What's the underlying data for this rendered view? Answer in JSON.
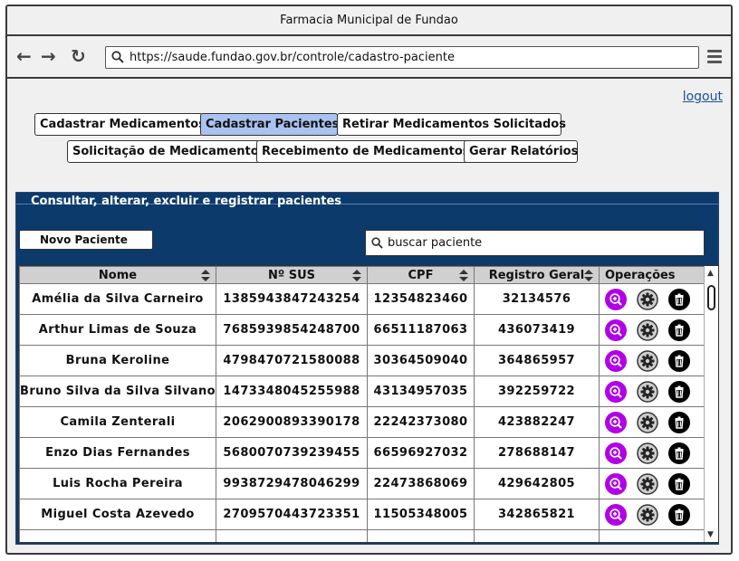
{
  "window": {
    "title": "Farmacia Municipal de Fundao"
  },
  "browser": {
    "url": "https://saude.fundao.gov.br/controle/cadastro-paciente"
  },
  "header": {
    "logout_label": "logout"
  },
  "tabs": [
    {
      "label": "Cadastrar Medicamentos",
      "active": false
    },
    {
      "label": "Cadastrar Pacientes",
      "active": true
    },
    {
      "label": "Retirar Medicamentos Solicitados",
      "active": false
    },
    {
      "label": "Solicitação de Medicamentos",
      "active": false
    },
    {
      "label": "Recebimento de Medicamentos",
      "active": false
    },
    {
      "label": "Gerar Relatórios",
      "active": false
    }
  ],
  "panel": {
    "title": "Consultar, alterar, excluir e registrar pacientes",
    "new_button_label": "Novo Paciente",
    "search_placeholder": "buscar paciente"
  },
  "table": {
    "columns": [
      "Nome",
      "Nº SUS",
      "CPF",
      "Registro Geral",
      "Operações"
    ],
    "rows": [
      [
        "Amélia da Silva Carneiro",
        "1385943847243254",
        "12354823460",
        "32134576"
      ],
      [
        "Arthur Limas de Souza",
        "7685939854248700",
        "66511187063",
        "436073419"
      ],
      [
        "Bruna Keroline",
        "4798470721580088",
        "30364509040",
        "364865957"
      ],
      [
        "Bruno Silva da Silva Silvano",
        "1473348045255988",
        "43134957035",
        "392259722"
      ],
      [
        "Camila Zenterali",
        "2062900893390178",
        "22242373080",
        "423882247"
      ],
      [
        "Enzo Dias Fernandes",
        "5680070739239455",
        "66596927032",
        "278688147"
      ],
      [
        "Luis Rocha Pereira",
        "9938729478046299",
        "22473868069",
        "429642805"
      ],
      [
        "Miguel Costa Azevedo",
        "2709570443723351",
        "11505348005",
        "342865821"
      ]
    ]
  },
  "icons": {
    "view": "magnifier-plus-icon",
    "edit": "gear-icon",
    "delete": "trash-icon"
  },
  "colors": {
    "panel_bg": "#0b3a6b",
    "active_tab": "#a9c2ef",
    "view_icon": "#b100e8",
    "edit_icon": "#cfcfcf",
    "delete_icon": "#000000",
    "link": "#1a4f9c"
  }
}
